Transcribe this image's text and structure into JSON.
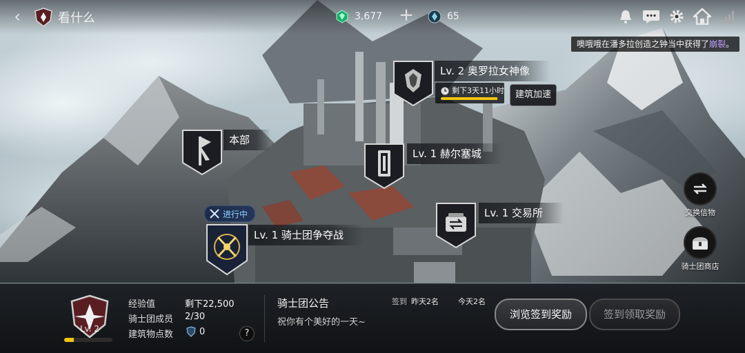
{
  "header": {
    "back_glyph": "‹",
    "title": "看什么",
    "gems": "3,677",
    "add_glyph": "+",
    "crystals": "65"
  },
  "ticker": {
    "prefix": "噢哦哦在潘多拉创造之钟当中获得了",
    "highlight": "崩裂",
    "suffix": "。"
  },
  "buildings": {
    "statue": {
      "label": "Lv. 2  奥罗拉女神像",
      "timer": "剩下3天11小时",
      "progress": 0.95,
      "speedup": "建筑加速"
    },
    "hq": {
      "label": "本部"
    },
    "castle": {
      "label": "Lv. 1  赫尔塞城"
    },
    "exchange": {
      "label": "Lv. 1  交易所"
    },
    "war": {
      "label": "Lv. 1  骑士团争夺战",
      "status": "进行中"
    }
  },
  "side_buttons": {
    "exchange_letter": "交换信物",
    "shop": "骑士团商店"
  },
  "guild_panel": {
    "level": "Lv. 2",
    "level_progress": 0.2,
    "exp_label": "经验值",
    "exp_value": "剩下22,500",
    "members_label": "骑士团成员",
    "members_value": "2/30",
    "points_label": "建筑物点数",
    "points_value": "0",
    "help_glyph": "?",
    "announcement_title": "骑士团公告",
    "announcement_body": "祝你有个美好的一天~",
    "checkin_label": "签到",
    "checkin_yesterday": "昨天2名",
    "checkin_today": "今天2名",
    "browse_button": "浏览签到奖励",
    "claim_button": "签到领取奖励"
  },
  "colors": {
    "gold": "#f1c40f",
    "highlight_purple": "#c29bff",
    "in_progress_blue": "#8fd3ff"
  },
  "icons": [
    "back-icon",
    "guild-shield-icon",
    "green-gem-icon",
    "blue-crystal-icon",
    "bell-icon",
    "chat-icon",
    "gear-icon",
    "home-icon",
    "signal-icon",
    "clock-icon",
    "swords-icon",
    "chest-icon"
  ]
}
